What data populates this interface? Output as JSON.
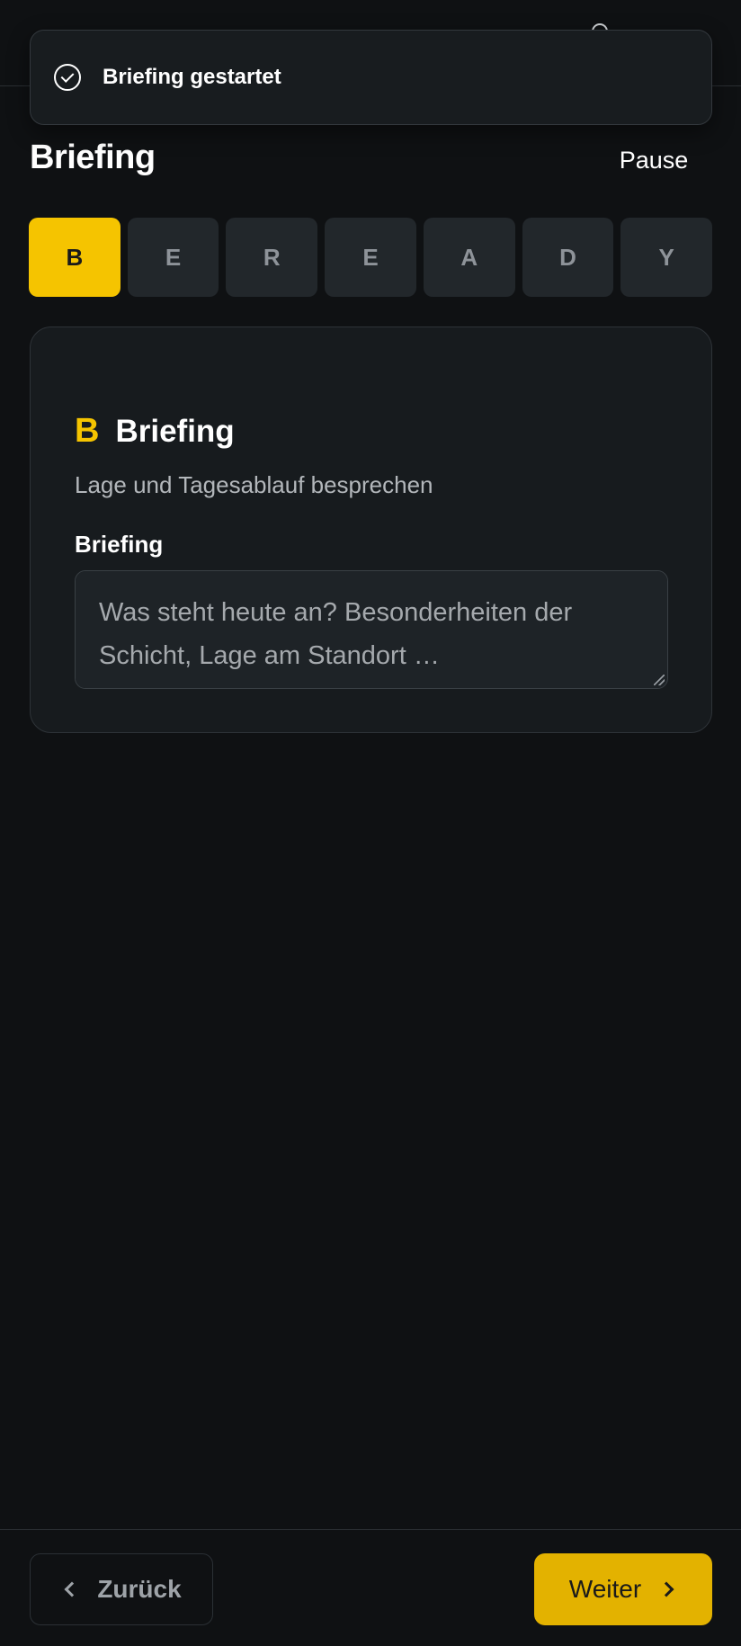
{
  "toast": {
    "message": "Briefing gestartet",
    "icon": "check-circle-icon"
  },
  "header": {
    "title": "Briefing",
    "pause_label": "Pause"
  },
  "steps": [
    {
      "letter": "B",
      "active": true
    },
    {
      "letter": "E",
      "active": false
    },
    {
      "letter": "R",
      "active": false
    },
    {
      "letter": "E",
      "active": false
    },
    {
      "letter": "A",
      "active": false
    },
    {
      "letter": "D",
      "active": false
    },
    {
      "letter": "Y",
      "active": false
    }
  ],
  "card": {
    "letter": "B",
    "title": "Briefing",
    "subtitle": "Lage und Tagesablauf besprechen",
    "field_label": "Briefing",
    "field_value": "",
    "field_placeholder": "Was steht heute an? Besonderheiten der Schicht, Lage am Standort …"
  },
  "footer": {
    "back_label": "Zurück",
    "next_label": "Weiter"
  },
  "colors": {
    "accent": "#f5c400",
    "background": "#0f1113",
    "card": "#171b1e"
  }
}
